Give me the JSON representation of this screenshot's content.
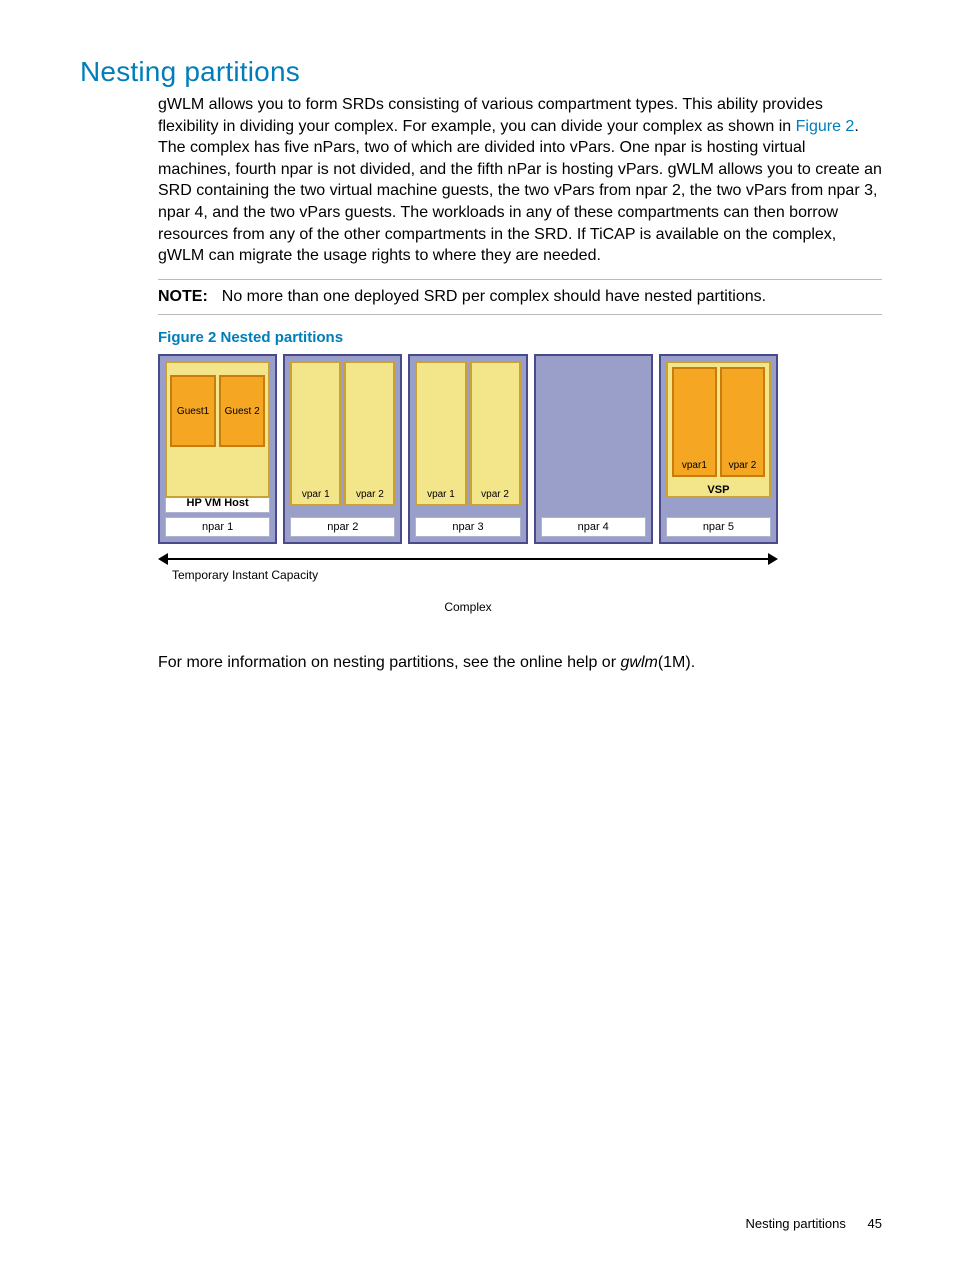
{
  "heading": "Nesting partitions",
  "paragraph_before_link": "gWLM allows you to form SRDs consisting of various compartment types. This ability provides flexibility in dividing your complex. For example, you can divide your complex as shown in ",
  "figure_link_text": "Figure 2",
  "paragraph_after_link": ". The complex has five nPars, two of which are divided into vPars. One npar is hosting virtual machines, fourth npar is not divided, and the fifth nPar is hosting vPars. gWLM allows you to create an SRD containing the two virtual machine guests, the two vPars from npar 2, the two vPars from npar 3, npar 4, and the two vPars guests. The workloads in any of these compartments can then borrow resources from any of the other compartments in the SRD. If TiCAP is available on the complex, gWLM can migrate the usage rights to where they are needed.",
  "note_label": "NOTE:",
  "note_text": "No more than one deployed SRD per complex should have nested partitions.",
  "figure_caption": "Figure 2 Nested partitions",
  "diagram": {
    "npar1": {
      "label": "npar 1",
      "host": "HP VM Host",
      "guest1": "Guest1",
      "guest2": "Guest 2"
    },
    "npar2": {
      "label": "npar 2",
      "vpar1": "vpar 1",
      "vpar2": "vpar 2"
    },
    "npar3": {
      "label": "npar 3",
      "vpar1": "vpar 1",
      "vpar2": "vpar 2"
    },
    "npar4": {
      "label": "npar 4"
    },
    "npar5": {
      "label": "npar 5",
      "vsp": "VSP",
      "vpar1": "vpar1",
      "vpar2": "vpar 2"
    },
    "ticap": "Temporary Instant Capacity",
    "complex": "Complex"
  },
  "closing_before_cmd": "For more information on nesting partitions, see the online help or ",
  "closing_cmd": "gwlm",
  "closing_after_cmd": "(1M).",
  "footer_title": "Nesting partitions",
  "footer_page": "45"
}
